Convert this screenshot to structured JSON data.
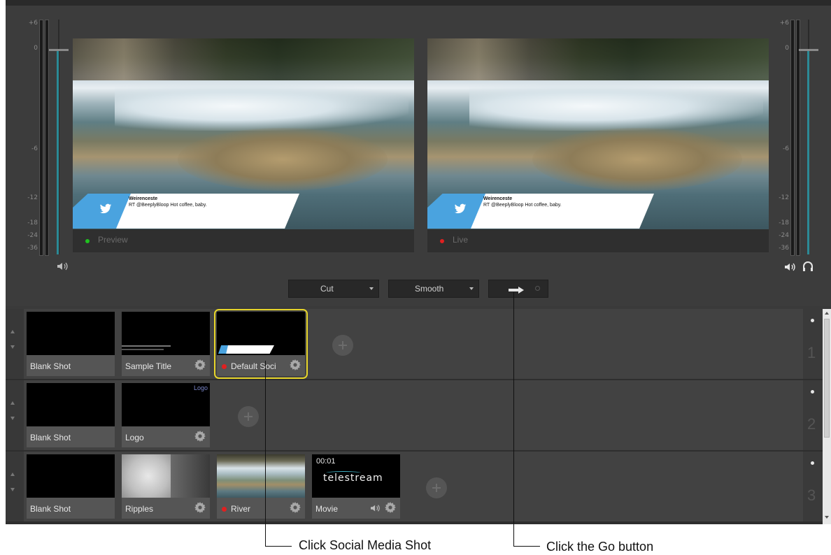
{
  "meters": {
    "scale_labels": [
      "+6",
      "0",
      "-6",
      "-12",
      "-18",
      "-24",
      "-36"
    ]
  },
  "preview": {
    "label": "Preview",
    "dot_color": "#1fc21f",
    "tweet_name": "Weirenceste",
    "tweet_text": "RT @BeeplyBloop Hot coffee, baby."
  },
  "live": {
    "label": "Live",
    "dot_color": "#e02020",
    "tweet_name": "Weirenceste",
    "tweet_text": "RT @BeeplyBloop Hot coffee, baby."
  },
  "controls": {
    "transition": "Cut",
    "speed": "Smooth",
    "go_icon": "arrow-right-icon"
  },
  "layers": [
    {
      "number": "1",
      "shots": [
        {
          "name": "Blank Shot"
        },
        {
          "name": "Sample Title"
        },
        {
          "name": "Default Soci"
        }
      ]
    },
    {
      "number": "2",
      "shots": [
        {
          "name": "Blank Shot"
        },
        {
          "name": "Logo",
          "thumb_text": "Logo"
        }
      ]
    },
    {
      "number": "3",
      "shots": [
        {
          "name": "Blank Shot"
        },
        {
          "name": "Ripples"
        },
        {
          "name": "River"
        },
        {
          "name": "Movie",
          "timecode": "00:01",
          "brand": "telestream"
        }
      ]
    }
  ],
  "callouts": {
    "social": "Click Social Media Shot",
    "go": "Click the Go button"
  },
  "colors": {
    "selected_outline": "#e7d52a",
    "live_red": "#e02020",
    "meter_teal": "#2b8a96",
    "twitter_blue": "#4aa3df"
  }
}
